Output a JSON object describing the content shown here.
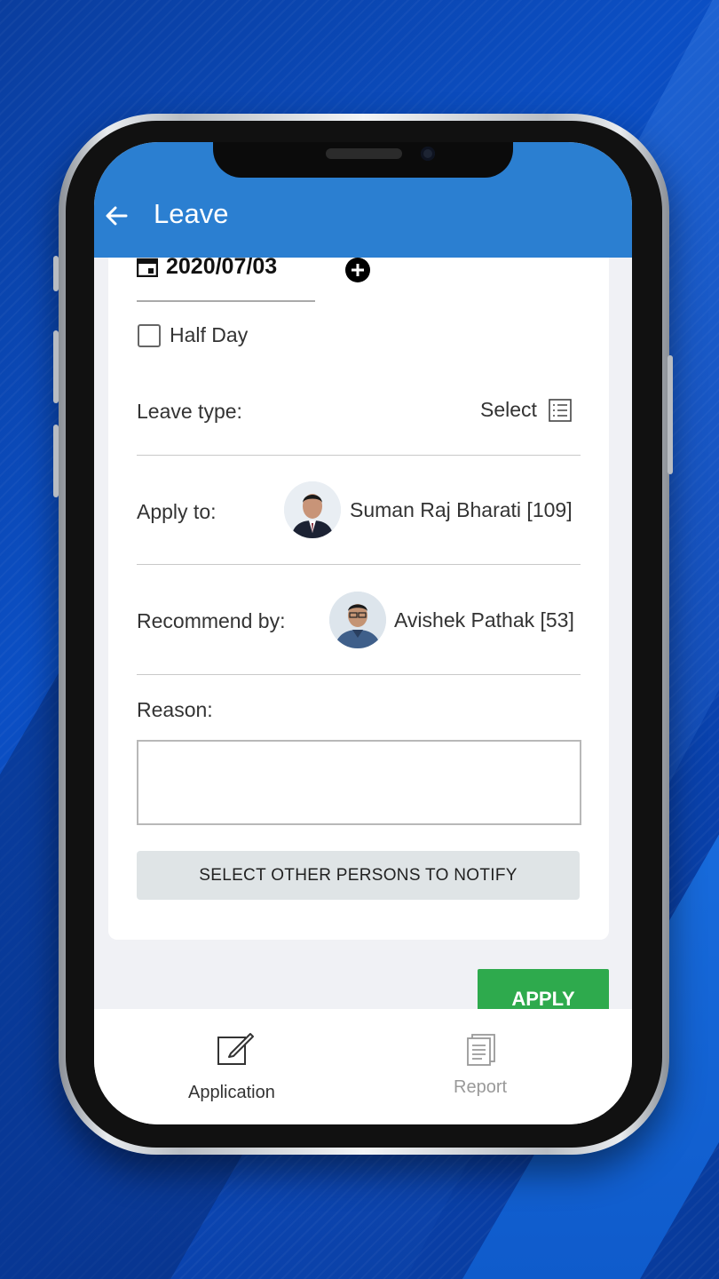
{
  "appbar": {
    "title": "Leave"
  },
  "form": {
    "date": "2020/07/03",
    "half_day_label": "Half Day",
    "leave_type_label": "Leave type:",
    "leave_type_value": "Select",
    "apply_to_label": "Apply to:",
    "apply_to_person": "Suman Raj Bharati [109]",
    "recommend_by_label": "Recommend by:",
    "recommend_by_person": "Avishek Pathak [53]",
    "reason_label": "Reason:",
    "reason_value": "",
    "notify_button": "SELECT OTHER PERSONS TO NOTIFY",
    "apply_button": "APPLY"
  },
  "bottom_nav": {
    "items": [
      {
        "label": "Application",
        "icon": "edit-icon",
        "active": true
      },
      {
        "label": "Report",
        "icon": "report-icon",
        "active": false
      }
    ]
  },
  "colors": {
    "appbar": "#2b7fd1",
    "apply": "#2eaa4d",
    "notify_button": "#dfe4e6"
  }
}
